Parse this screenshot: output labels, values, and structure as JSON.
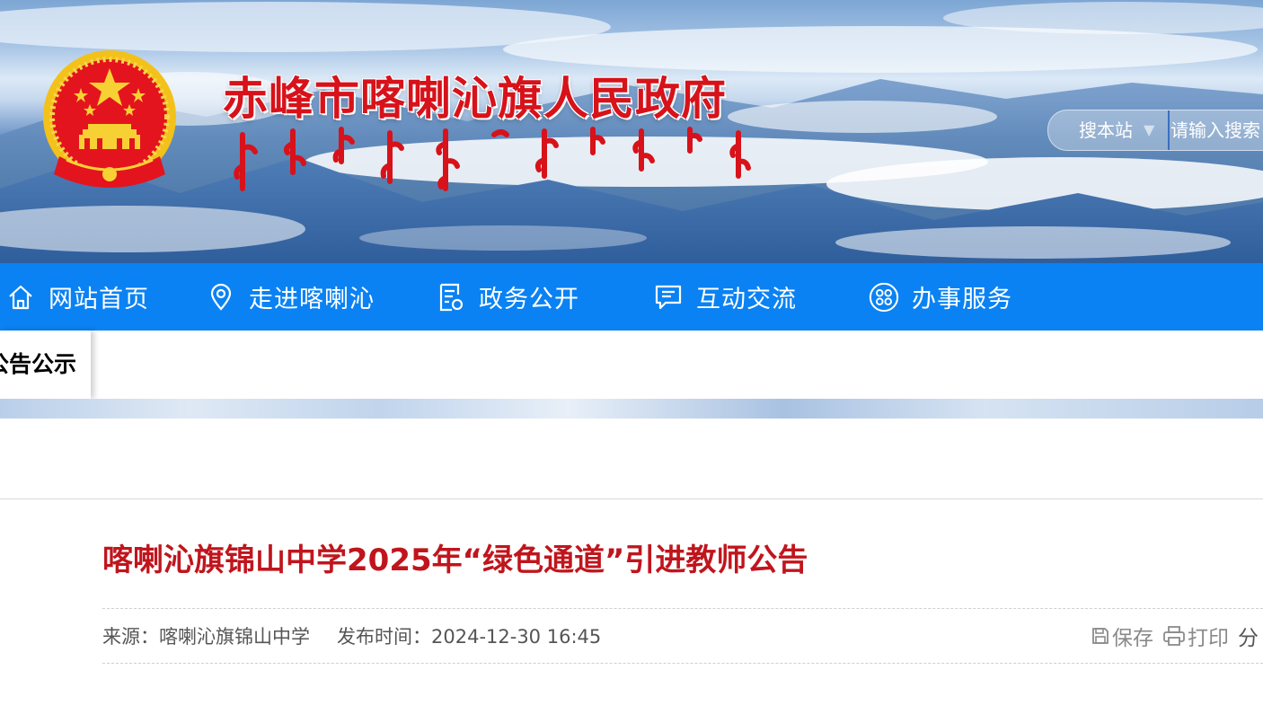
{
  "header": {
    "site_title": "赤峰市喀喇沁旗人民政府",
    "search": {
      "scope_label": "搜本站",
      "placeholder": "请输入搜索"
    }
  },
  "nav": {
    "items": [
      {
        "label": "网站首页",
        "icon": "home-icon"
      },
      {
        "label": "走进喀喇沁",
        "icon": "location-pin-icon"
      },
      {
        "label": "政务公开",
        "icon": "document-icon"
      },
      {
        "label": "互动交流",
        "icon": "chat-icon"
      },
      {
        "label": "办事服务",
        "icon": "grid-circle-icon"
      }
    ],
    "background": "#0a82f3"
  },
  "breadcrumb": {
    "active_tab": "公告公示"
  },
  "article": {
    "title": "喀喇沁旗锦山中学2025年“绿色通道”引进教师公告",
    "source_label": "来源：喀喇沁旗锦山中学",
    "publish_label": "发布时间：2024-12-30 16:45",
    "tools": {
      "save": "保存",
      "print": "打印",
      "share": "分"
    }
  },
  "colors": {
    "title_red": "#c0151d",
    "site_title_red": "#d7121a"
  }
}
